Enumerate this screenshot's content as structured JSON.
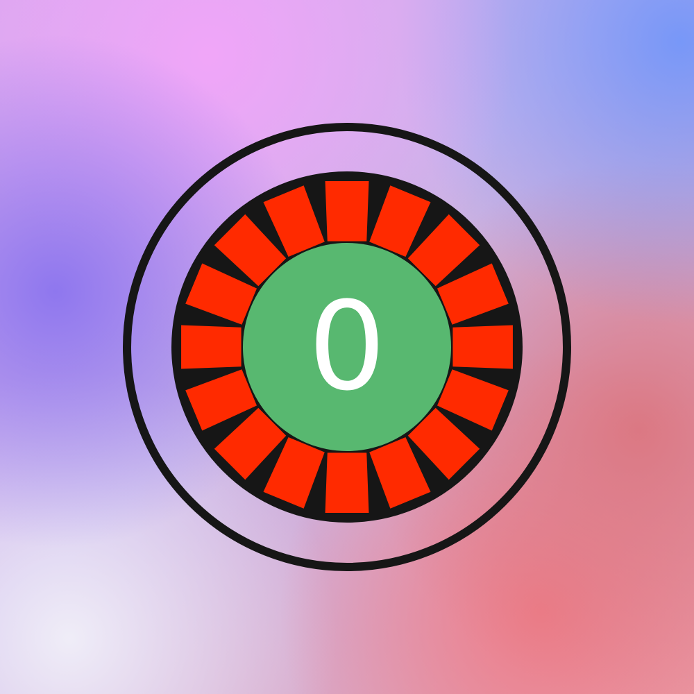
{
  "icon": {
    "name": "roulette-wheel-icon",
    "center_value": "0",
    "pocket_count": 16,
    "colors": {
      "ring": "#161616",
      "pocket": "#ff2a00",
      "center": "#58b870",
      "text": "#ffffff"
    }
  }
}
